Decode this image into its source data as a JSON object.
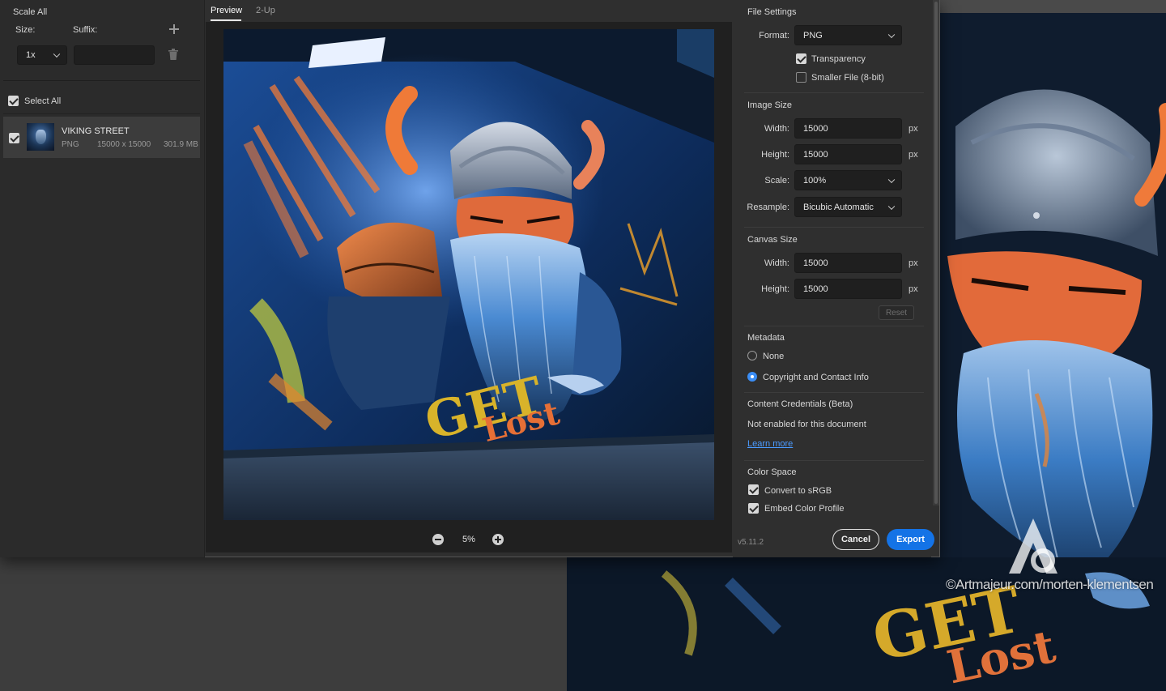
{
  "left_panel": {
    "scale_all_title": "Scale All",
    "size_label": "Size:",
    "suffix_label": "Suffix:",
    "size_value": "1x",
    "suffix_value": "",
    "select_all_label": "Select All",
    "asset": {
      "name": "VIKING STREET",
      "format": "PNG",
      "dimensions": "15000 x 15000",
      "file_size": "301.9 MB"
    }
  },
  "preview": {
    "tabs": [
      {
        "label": "Preview",
        "active": true
      },
      {
        "label": "2-Up",
        "active": false
      }
    ],
    "zoom": "5%",
    "artwork_text": {
      "top_word": "GET",
      "bottom_word": "Lost"
    }
  },
  "file_settings": {
    "title": "File Settings",
    "format_label": "Format:",
    "format_value": "PNG",
    "transparency_label": "Transparency",
    "transparency_checked": true,
    "smaller_file_label": "Smaller File (8-bit)",
    "smaller_file_checked": false
  },
  "image_size": {
    "title": "Image Size",
    "width_label": "Width:",
    "width_value": "15000",
    "height_label": "Height:",
    "height_value": "15000",
    "scale_label": "Scale:",
    "scale_value": "100%",
    "resample_label": "Resample:",
    "resample_value": "Bicubic Automatic",
    "unit": "px"
  },
  "canvas_size": {
    "title": "Canvas Size",
    "width_label": "Width:",
    "width_value": "15000",
    "height_label": "Height:",
    "height_value": "15000",
    "unit": "px",
    "reset_label": "Reset"
  },
  "metadata": {
    "title": "Metadata",
    "options": [
      {
        "label": "None",
        "selected": false
      },
      {
        "label": "Copyright and Contact Info",
        "selected": true
      }
    ]
  },
  "content_credentials": {
    "title": "Content Credentials (Beta)",
    "status": "Not enabled for this document",
    "learn_more": "Learn more"
  },
  "color_space": {
    "title": "Color Space",
    "convert_label": "Convert to sRGB",
    "convert_checked": true,
    "embed_label": "Embed Color Profile",
    "embed_checked": true
  },
  "footer": {
    "version": "v5.11.2",
    "cancel_label": "Cancel",
    "export_label": "Export"
  },
  "background": {
    "watermark": "©Artmajeur.com/morten-klementsen",
    "artwork_text": {
      "top_word": "GET",
      "bottom_word": "Lost"
    }
  },
  "colors": {
    "accent": "#1473e6",
    "link": "#4b9bff",
    "panel": "#2f2f2f"
  }
}
